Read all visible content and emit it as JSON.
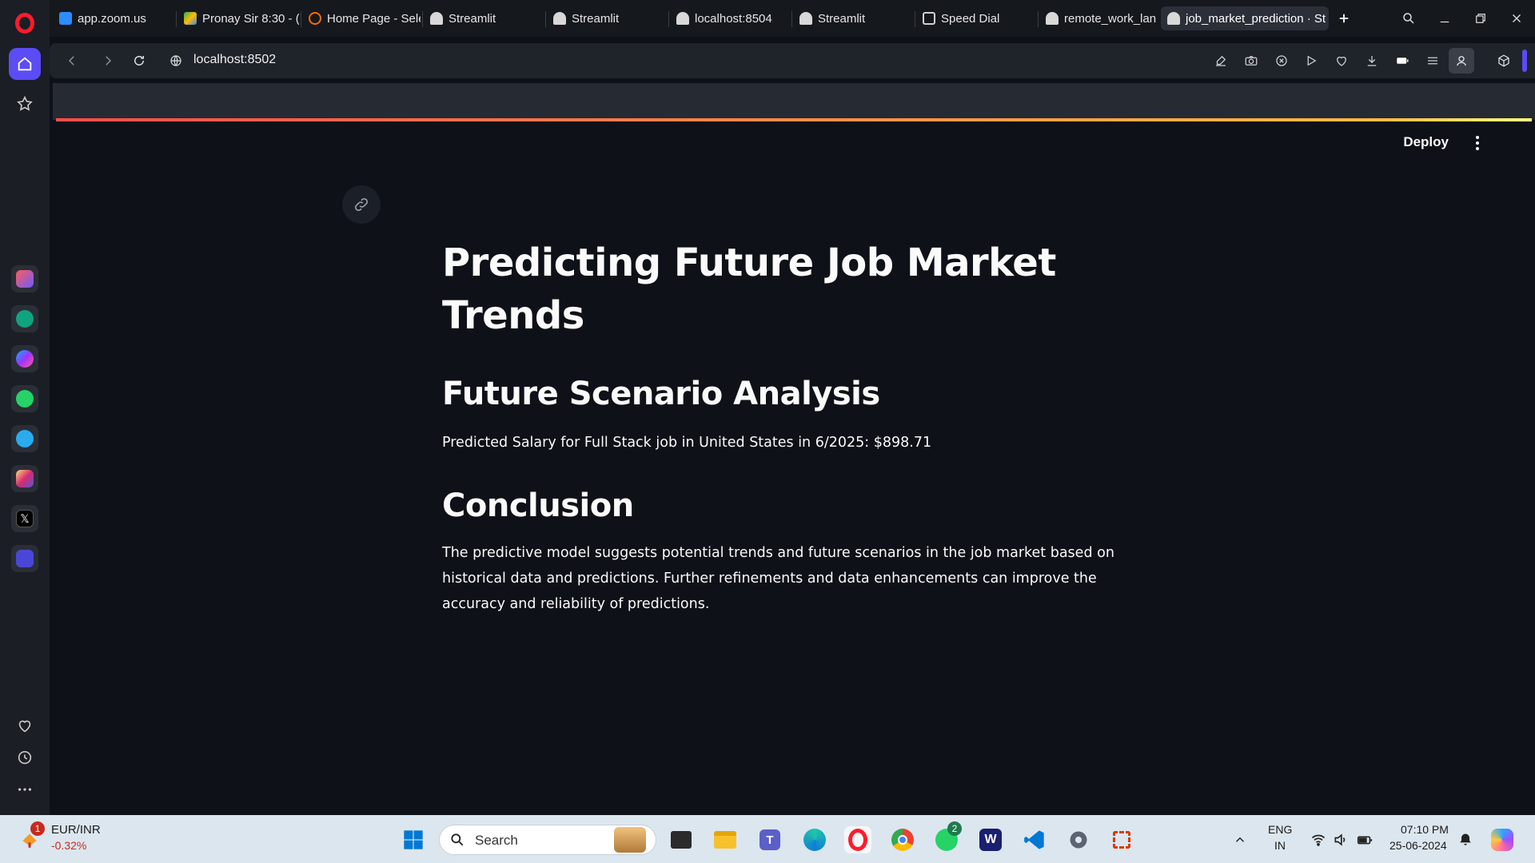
{
  "browser": {
    "tabs": [
      {
        "label": "app.zoom.us",
        "color": "#2d8cff"
      },
      {
        "label": "Pronay Sir 8:30 - (",
        "color": "#34a853"
      },
      {
        "label": "Home Page - Sele",
        "color": "#ff6a00"
      },
      {
        "label": "Streamlit",
        "color": "#e8e8e8"
      },
      {
        "label": "Streamlit",
        "color": "#e8e8e8"
      },
      {
        "label": "localhost:8504",
        "color": "#e8e8e8"
      },
      {
        "label": "Streamlit",
        "color": "#e8e8e8"
      },
      {
        "label": "Speed Dial",
        "color": "#cfcfcf"
      },
      {
        "label": "remote_work_lan",
        "color": "#e8e8e8"
      },
      {
        "label": "job_market_prediction · St",
        "color": "#e8e8e8"
      }
    ],
    "url": "localhost:8502"
  },
  "streamlit": {
    "deploy_label": "Deploy",
    "title": "Predicting Future Job Market Trends",
    "section1": "Future Scenario Analysis",
    "prediction": "Predicted Salary for Full Stack job in United States in 6/2025: $898.71",
    "section2": "Conclusion",
    "conclusion": "The predictive model suggests potential trends and future scenarios in the job market based on historical data and predictions. Further refinements and data enhancements can improve the accuracy and reliability of predictions."
  },
  "taskbar": {
    "ticker_name": "EUR/INR",
    "ticker_change": "-0.32%",
    "ticker_badge": "1",
    "search_placeholder": "Search",
    "whatsapp_badge": "2",
    "lang_line1": "ENG",
    "lang_line2": "IN",
    "time": "07:10 PM",
    "date": "25-06-2024"
  },
  "colors": {
    "accent": "#ff4b4b",
    "opera_red": "#ff1b2d",
    "sidebar_active": "#5b4cf5",
    "ticker_negative": "#c42b1c"
  }
}
